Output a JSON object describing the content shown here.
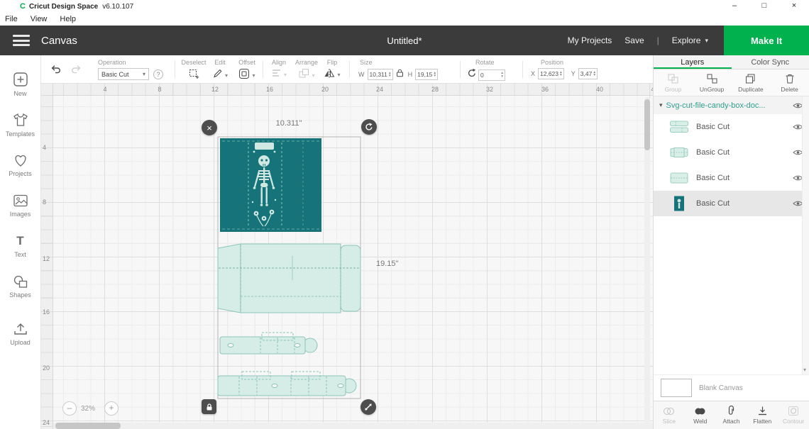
{
  "icons": {
    "logo_glyph": "C",
    "chevron_down": "▾",
    "stepper_up": "▴",
    "stepper_down": "▾",
    "close": "×",
    "minimize": "–",
    "maximize": "□",
    "help": "?",
    "zoom_out": "–",
    "zoom_in": "+",
    "text_glyph": "T",
    "menu_divider": "|"
  },
  "titlebar": {
    "app": "Cricut Design Space",
    "version": "v6.10.107"
  },
  "menubar": {
    "items": [
      {
        "label": "File"
      },
      {
        "label": "View"
      },
      {
        "label": "Help"
      }
    ]
  },
  "header": {
    "canvas": "Canvas",
    "title": "Untitled*",
    "my_projects": "My Projects",
    "save": "Save",
    "explore": "Explore",
    "make_it": "Make It"
  },
  "toolbar": {
    "operation": {
      "label": "Operation",
      "value": "Basic Cut"
    },
    "deselect": {
      "label": "Deselect"
    },
    "edit": {
      "label": "Edit"
    },
    "offset": {
      "label": "Offset"
    },
    "align": {
      "label": "Align"
    },
    "arrange": {
      "label": "Arrange"
    },
    "flip": {
      "label": "Flip"
    },
    "size": {
      "label": "Size",
      "w_label": "W",
      "w_value": "10,311",
      "h_label": "H",
      "h_value": "19,15"
    },
    "rotate": {
      "label": "Rotate",
      "value": "0"
    },
    "position": {
      "label": "Position",
      "x_label": "X",
      "x_value": "12,623",
      "y_label": "Y",
      "y_value": "3,47"
    }
  },
  "sidebar": {
    "items": [
      {
        "label": "New"
      },
      {
        "label": "Templates"
      },
      {
        "label": "Projects"
      },
      {
        "label": "Images"
      },
      {
        "label": "Text"
      },
      {
        "label": "Shapes"
      },
      {
        "label": "Upload"
      }
    ]
  },
  "canvas": {
    "ruler_h": [
      "4",
      "8",
      "12",
      "16",
      "20",
      "24",
      "28",
      "32",
      "36",
      "40",
      "4"
    ],
    "ruler_v": [
      "4",
      "8",
      "12",
      "16",
      "20",
      "24"
    ],
    "selection_width": "10.311\"",
    "selection_height": "19.15\"",
    "zoom_value": "32%"
  },
  "layers_panel": {
    "tabs": {
      "layers": "Layers",
      "color_sync": "Color Sync"
    },
    "actions": [
      {
        "label": "Group"
      },
      {
        "label": "UnGroup"
      },
      {
        "label": "Duplicate"
      },
      {
        "label": "Delete"
      }
    ],
    "group_name": "Svg-cut-file-candy-box-doc...",
    "layers": [
      {
        "label": "Basic Cut"
      },
      {
        "label": "Basic Cut"
      },
      {
        "label": "Basic Cut"
      },
      {
        "label": "Basic Cut"
      }
    ],
    "blank_canvas": "Blank Canvas",
    "bottom_actions": [
      {
        "label": "Slice"
      },
      {
        "label": "Weld"
      },
      {
        "label": "Attach"
      },
      {
        "label": "Flatten"
      },
      {
        "label": "Contour"
      }
    ]
  },
  "colors": {
    "accent_green": "#00b14e",
    "header_dark": "#3b3b3b",
    "artwork_teal": "#17737a",
    "artwork_mint": "#d6ede7",
    "layer_name_teal": "#2fa08e"
  }
}
